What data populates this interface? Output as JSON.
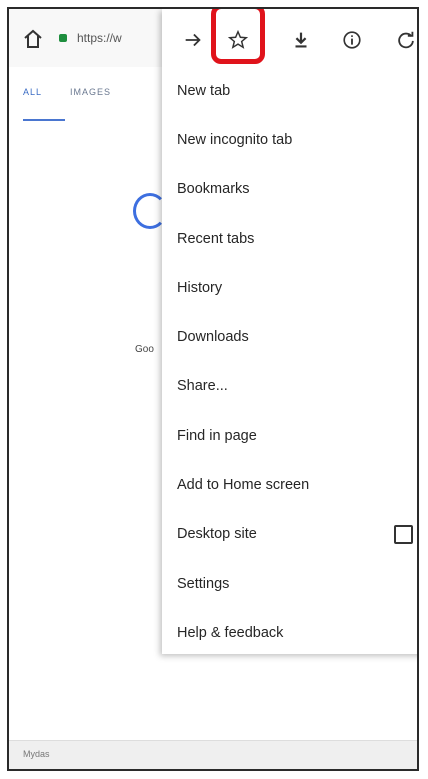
{
  "toolbar": {
    "url_text": "https://w",
    "home_icon": "home-icon",
    "lock_icon": "lock-icon"
  },
  "page": {
    "tabs": [
      "ALL",
      "IMAGES"
    ],
    "partial_text": "Goo",
    "bottom_text": "Mydas"
  },
  "menu": {
    "icons": [
      "forward-icon",
      "bookmark-star-icon",
      "download-icon",
      "info-icon",
      "refresh-icon"
    ],
    "items": [
      {
        "label": "New tab"
      },
      {
        "label": "New incognito tab"
      },
      {
        "label": "Bookmarks"
      },
      {
        "label": "Recent tabs"
      },
      {
        "label": "History"
      },
      {
        "label": "Downloads"
      },
      {
        "label": "Share..."
      },
      {
        "label": "Find in page"
      },
      {
        "label": "Add to Home screen"
      },
      {
        "label": "Desktop site"
      },
      {
        "label": "Settings"
      },
      {
        "label": "Help & feedback"
      }
    ]
  },
  "colors": {
    "highlight": "#e0131b",
    "lock": "#1e8e3e",
    "accent": "#3b6cc4"
  }
}
